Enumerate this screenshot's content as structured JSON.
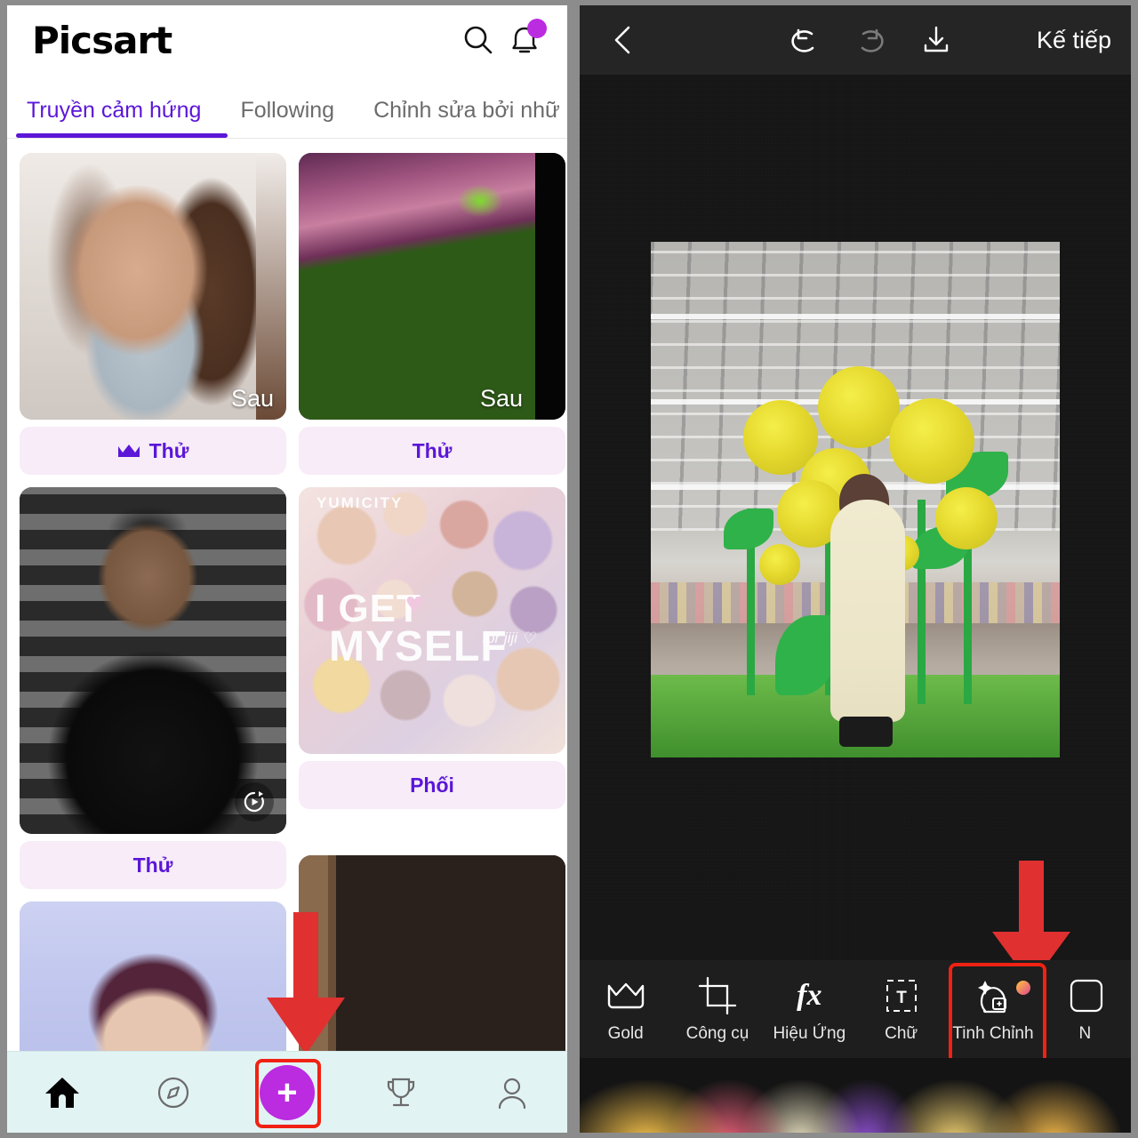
{
  "app": {
    "brand": "Picsart",
    "accent_purple": "#5b16d8",
    "accent_magenta": "#bb2be0",
    "highlight_red": "#f02213"
  },
  "left_panel": {
    "header": {
      "brand": "Picsart",
      "search_icon": "search-icon",
      "notifications_icon": "bell-icon",
      "notification_dot": true
    },
    "tabs": [
      {
        "label": "Truyền cảm hứng",
        "active": true
      },
      {
        "label": "Following",
        "active": false
      },
      {
        "label": "Chỉnh sửa bởi nhữ",
        "active": false
      }
    ],
    "feed": {
      "cards": [
        {
          "name": "card-smiling-woman",
          "overlay_label": "Sau",
          "button_label": "Thử",
          "has_crown": true
        },
        {
          "name": "card-fantasy-umbrella",
          "overlay_label": "Sau",
          "button_label": "Thử",
          "has_crown": false
        },
        {
          "name": "card-man-leather-jacket",
          "overlay_label": "",
          "button_label": "Thử",
          "has_crown": false,
          "has_replay": true
        },
        {
          "name": "card-collage",
          "overlay_label": "",
          "button_label": "Phối",
          "has_crown": false,
          "collage_text": {
            "watermark": "YUMICITY",
            "line1": "I GET",
            "line2": "MYSELF",
            "credit": "for jiji ♡"
          }
        },
        {
          "name": "card-avatar-frame",
          "overlay_label": "",
          "button_label": "",
          "has_crown": false
        },
        {
          "name": "card-mirror-selfie",
          "overlay_label": "",
          "button_label": "",
          "has_crown": false
        }
      ]
    },
    "bottom_nav": [
      {
        "name": "nav-home",
        "icon": "home-icon",
        "active": true
      },
      {
        "name": "nav-discover",
        "icon": "compass-icon",
        "active": false
      },
      {
        "name": "nav-create",
        "icon": "plus-icon",
        "active": false,
        "highlighted": true
      },
      {
        "name": "nav-challenges",
        "icon": "trophy-icon",
        "active": false
      },
      {
        "name": "nav-profile",
        "icon": "person-icon",
        "active": false
      }
    ]
  },
  "right_panel": {
    "header": {
      "back_icon": "chevron-left-icon",
      "undo_icon": "undo-icon",
      "redo_icon": "redo-icon",
      "download_icon": "download-icon",
      "next_label": "Kế tiếp"
    },
    "canvas": {
      "name": "photo-canvas",
      "description": "supermarket-yellow-roses-photo"
    },
    "toolbar": [
      {
        "name": "tool-gold",
        "label": "Gold",
        "icon": "crown-icon",
        "highlighted": false
      },
      {
        "name": "tool-tools",
        "label": "Công cụ",
        "icon": "crop-icon",
        "highlighted": false
      },
      {
        "name": "tool-effects",
        "label": "Hiệu Ứng",
        "icon": "fx-icon",
        "highlighted": false
      },
      {
        "name": "tool-text",
        "label": "Chữ",
        "icon": "text-icon",
        "highlighted": false
      },
      {
        "name": "tool-retouch",
        "label": "Tinh Chỉnh",
        "icon": "retouch-face-icon",
        "highlighted": true,
        "badge": true
      },
      {
        "name": "tool-more",
        "label": "N",
        "icon": "sticker-icon",
        "highlighted": false
      }
    ]
  },
  "annotations": [
    {
      "name": "arrow-to-create-button",
      "color": "#e03030",
      "points_to": "nav-create"
    },
    {
      "name": "arrow-to-retouch-tool",
      "color": "#e03030",
      "points_to": "tool-retouch"
    }
  ]
}
